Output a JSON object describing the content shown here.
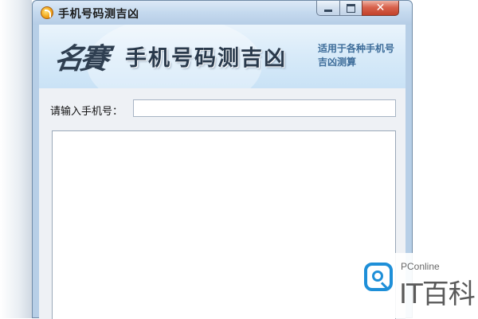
{
  "window": {
    "title": "手机号码测吉凶",
    "controls": {
      "minimize": "minimize-icon",
      "maximize": "maximize-icon",
      "close": "close-icon"
    }
  },
  "banner": {
    "logo": "名賽",
    "title": "手机号码测吉凶",
    "subtitle": "适用于各种手机号吉凶测算"
  },
  "form": {
    "input_label": "请输入手机号：",
    "phone_value": "",
    "result_value": ""
  },
  "watermark": {
    "brand": "PConline",
    "text": "IT百科"
  },
  "colors": {
    "frame": "#b7cfe7",
    "close_button": "#d8634d",
    "banner_title": "#2a3a4c",
    "banner_subtitle": "#3e6d9a",
    "watermark_blue": "#1e8fd8"
  }
}
